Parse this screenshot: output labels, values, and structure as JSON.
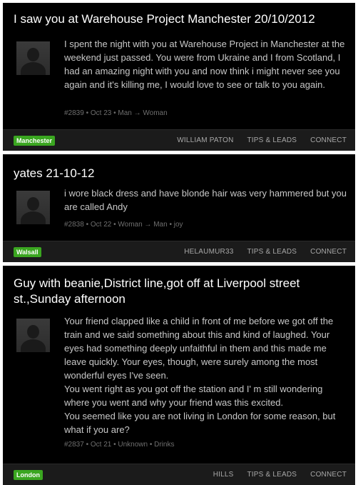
{
  "posts": [
    {
      "title": "I saw you at Warehouse Project Manchester 20/10/2012",
      "body": "I spent the night with you at Warehouse Project in Manchester at the weekend just passed.  You were from Ukraine and I from Scotland, I had an amazing night with you and now think i might never see you again and it's killing me, I would love to see or talk to you again.",
      "meta": "#2839 • Oct 23 • Man → Woman",
      "location_tag": "Manchester",
      "author": "WILLIAM PATON",
      "tips_label": "TIPS & LEADS",
      "connect_label": "CONNECT"
    },
    {
      "title": "yates 21-10-12",
      "body": "i wore black dress and have blonde hair was very hammered but you are called Andy",
      "meta": "#2838 • Oct 22 • Woman → Man • joy",
      "location_tag": "Walsall",
      "author": "HELAUMUR33",
      "tips_label": "TIPS & LEADS",
      "connect_label": "CONNECT"
    },
    {
      "title": "Guy with beanie,District line,got off at Liverpool street st.,Sunday afternoon",
      "body_paragraphs": [
        "Your friend clapped like a child in front of me before we got off the train and we said something about this and kind of laughed. Your eyes had something deeply unfaithful in them and this made me leave quickly. Your eyes, though, were surely among the most wonderful eyes I've seen.",
        "You went right as you got off the station and I' m still wondering where you went and why your friend was this excited.",
        "You seemed like you are not living in London for some reason, but what if you are?"
      ],
      "meta": "#2837 • Oct 21 • Unknown • Drinks",
      "location_tag": "London",
      "author": "HILLS",
      "tips_label": "TIPS & LEADS",
      "connect_label": "CONNECT"
    }
  ],
  "colors": {
    "card_bg": "#000000",
    "footer_bg": "#1b1b1b",
    "tag_green": "#3aa620",
    "body_text": "#c8c8c8",
    "meta_text": "#6e6e6e"
  },
  "icons": {
    "avatar": "default-user-silhouette-icon"
  }
}
